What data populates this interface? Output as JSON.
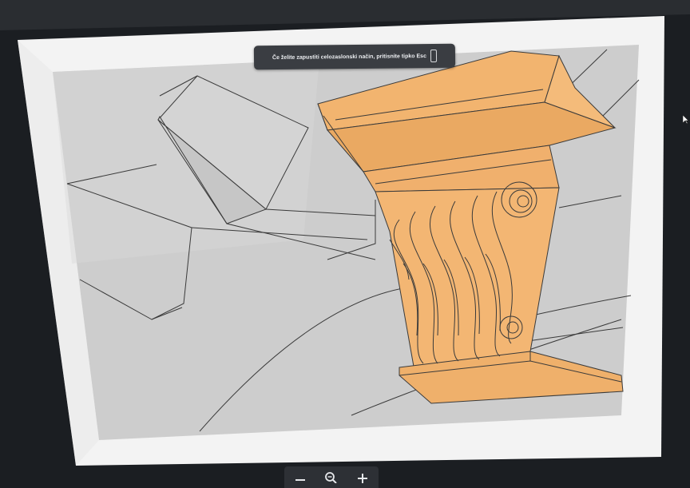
{
  "fullscreen_banner": {
    "message": "Če želite zapustiti celozaslonski način, pritisnite tipko Esc",
    "key": ""
  },
  "zoom_controls": {
    "zoom_out_icon": "minus-icon",
    "zoom_reset_icon": "magnifier-icon",
    "zoom_in_icon": "plus-icon"
  },
  "colors": {
    "bezel": "#1b1e22",
    "canvas": "#cfcfcf",
    "corbel": "#f0b06d",
    "line": "#3a3a3a"
  }
}
